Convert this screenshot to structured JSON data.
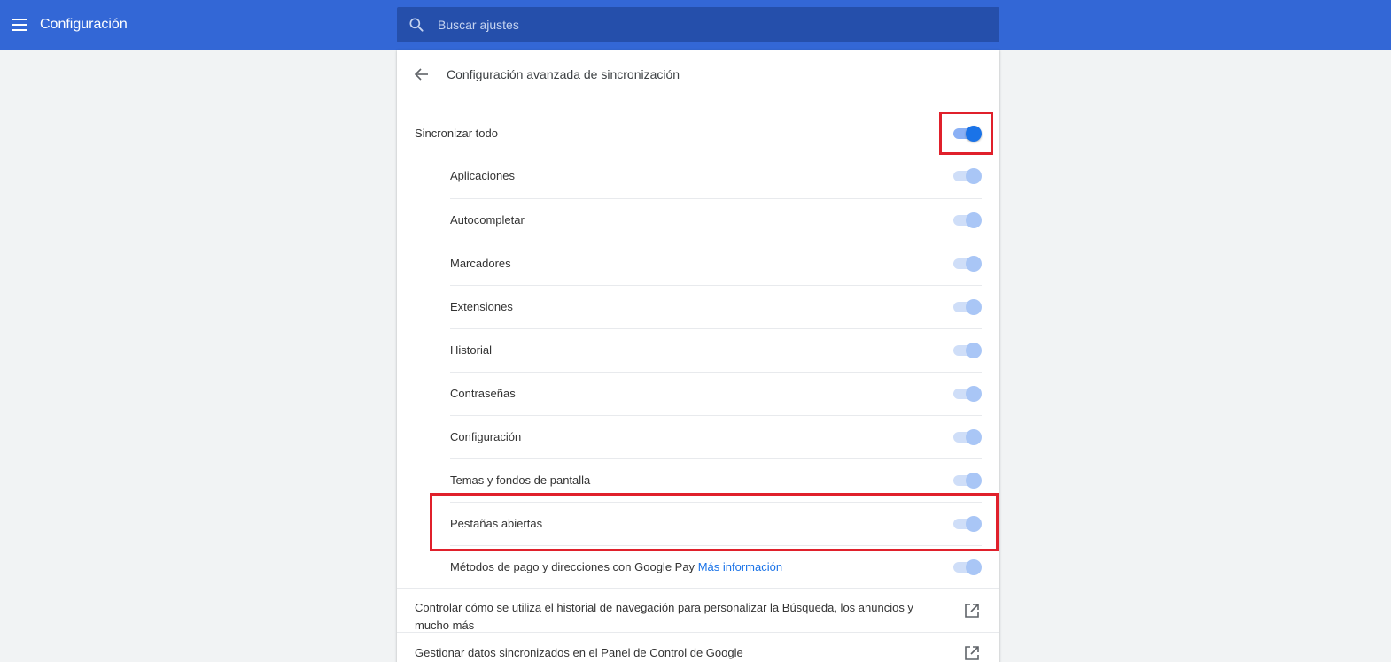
{
  "header": {
    "title": "Configuración",
    "search_placeholder": "Buscar ajustes"
  },
  "subpage": {
    "title": "Configuración avanzada de sincronización"
  },
  "sync_all": {
    "label": "Sincronizar todo",
    "enabled": true
  },
  "items": [
    {
      "label": "Aplicaciones"
    },
    {
      "label": "Autocompletar"
    },
    {
      "label": "Marcadores"
    },
    {
      "label": "Extensiones"
    },
    {
      "label": "Historial"
    },
    {
      "label": "Contraseñas"
    },
    {
      "label": "Configuración"
    },
    {
      "label": "Temas y fondos de pantalla"
    },
    {
      "label": "Pestañas abiertas"
    },
    {
      "label": "Métodos de pago y direcciones con Google Pay",
      "link": "Más información"
    }
  ],
  "links": [
    {
      "text_line1": "Controlar cómo se utiliza el historial de navegación para personalizar la Búsqueda, los anuncios y",
      "text_line2": "mucho más"
    },
    {
      "text": "Gestionar datos sincronizados en el Panel de Control de Google"
    }
  ],
  "colors": {
    "header_bg": "#3367d6",
    "search_bg": "#254fab",
    "toggle_on": "#1a73e8",
    "toggle_disabled": "#a9c6f6",
    "highlight": "#e0202b",
    "link": "#1a73e8"
  },
  "icons": {
    "menu": "menu-icon",
    "search": "search-icon",
    "back": "back-arrow-icon",
    "external": "external-link-icon"
  }
}
